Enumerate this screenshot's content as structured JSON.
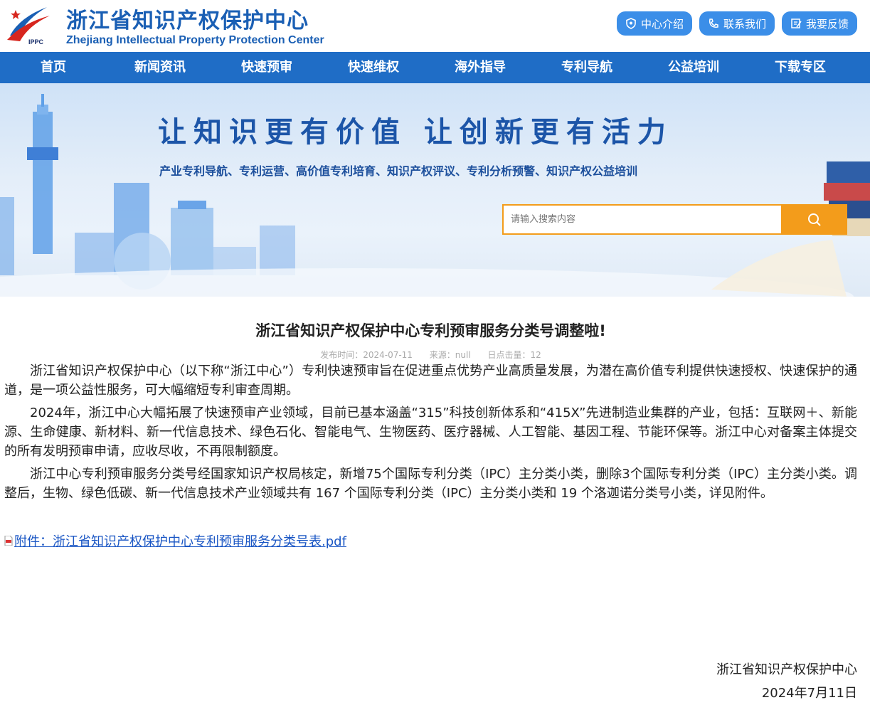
{
  "header": {
    "logo_text": "IPPC",
    "title": "浙江省知识产权保护中心",
    "subtitle": "Zhejiang Intellectual Property Protection Center",
    "buttons": [
      {
        "label": "中心介绍",
        "icon": "shield-icon"
      },
      {
        "label": "联系我们",
        "icon": "phone-icon"
      },
      {
        "label": "我要反馈",
        "icon": "edit-icon"
      }
    ]
  },
  "nav": {
    "items": [
      "首页",
      "新闻资讯",
      "快速预审",
      "快速维权",
      "海外指导",
      "专利导航",
      "公益培训",
      "下载专区"
    ]
  },
  "banner": {
    "slogan": "让知识更有价值 让创新更有活力",
    "services": "产业专利导航、专利运营、高价值专利培育、知识产权评议、专利分析预警、知识产权公益培训",
    "search_placeholder": "请输入搜索内容"
  },
  "article": {
    "title": "浙江省知识产权保护中心专利预审服务分类号调整啦!",
    "meta": {
      "publish_time": "发布时间：2024-07-11",
      "source": "来源：null",
      "views": "日点击量：12"
    },
    "paragraphs": [
      "浙江省知识产权保护中心（以下称“浙江中心”）专利快速预审旨在促进重点优势产业高质量发展，为潜在高价值专利提供快速授权、快速保护的通道，是一项公益性服务，可大幅缩短专利审查周期。",
      "2024年，浙江中心大幅拓展了快速预审产业领域，目前已基本涵盖“315”科技创新体系和“415X”先进制造业集群的产业，包括：互联网＋、新能源、生命健康、新材料、新一代信息技术、绿色石化、智能电气、生物医药、医疗器械、人工智能、基因工程、节能环保等。浙江中心对备案主体提交的所有发明预审申请，应收尽收，不再限制额度。",
      "浙江中心专利预审服务分类号经国家知识产权局核定，新增75个国际专利分类（IPC）主分类小类，删除3个国际专利分类（IPC）主分类小类。调整后，生物、绿色低碳、新一代信息技术产业领域共有 167 个国际专利分类（IPC）主分类小类和 19 个洛迦诺分类号小类，详见附件。"
    ],
    "attachment": "附件：浙江省知识产权保护中心专利预审服务分类号表.pdf",
    "sign_org": "浙江省知识产权保护中心",
    "sign_date": "2024年7月11日"
  },
  "colors": {
    "brand_blue": "#1a5fb4",
    "nav_blue": "#1f6dc6",
    "search_orange": "#f39c1b",
    "link_blue": "#1a56c4"
  }
}
